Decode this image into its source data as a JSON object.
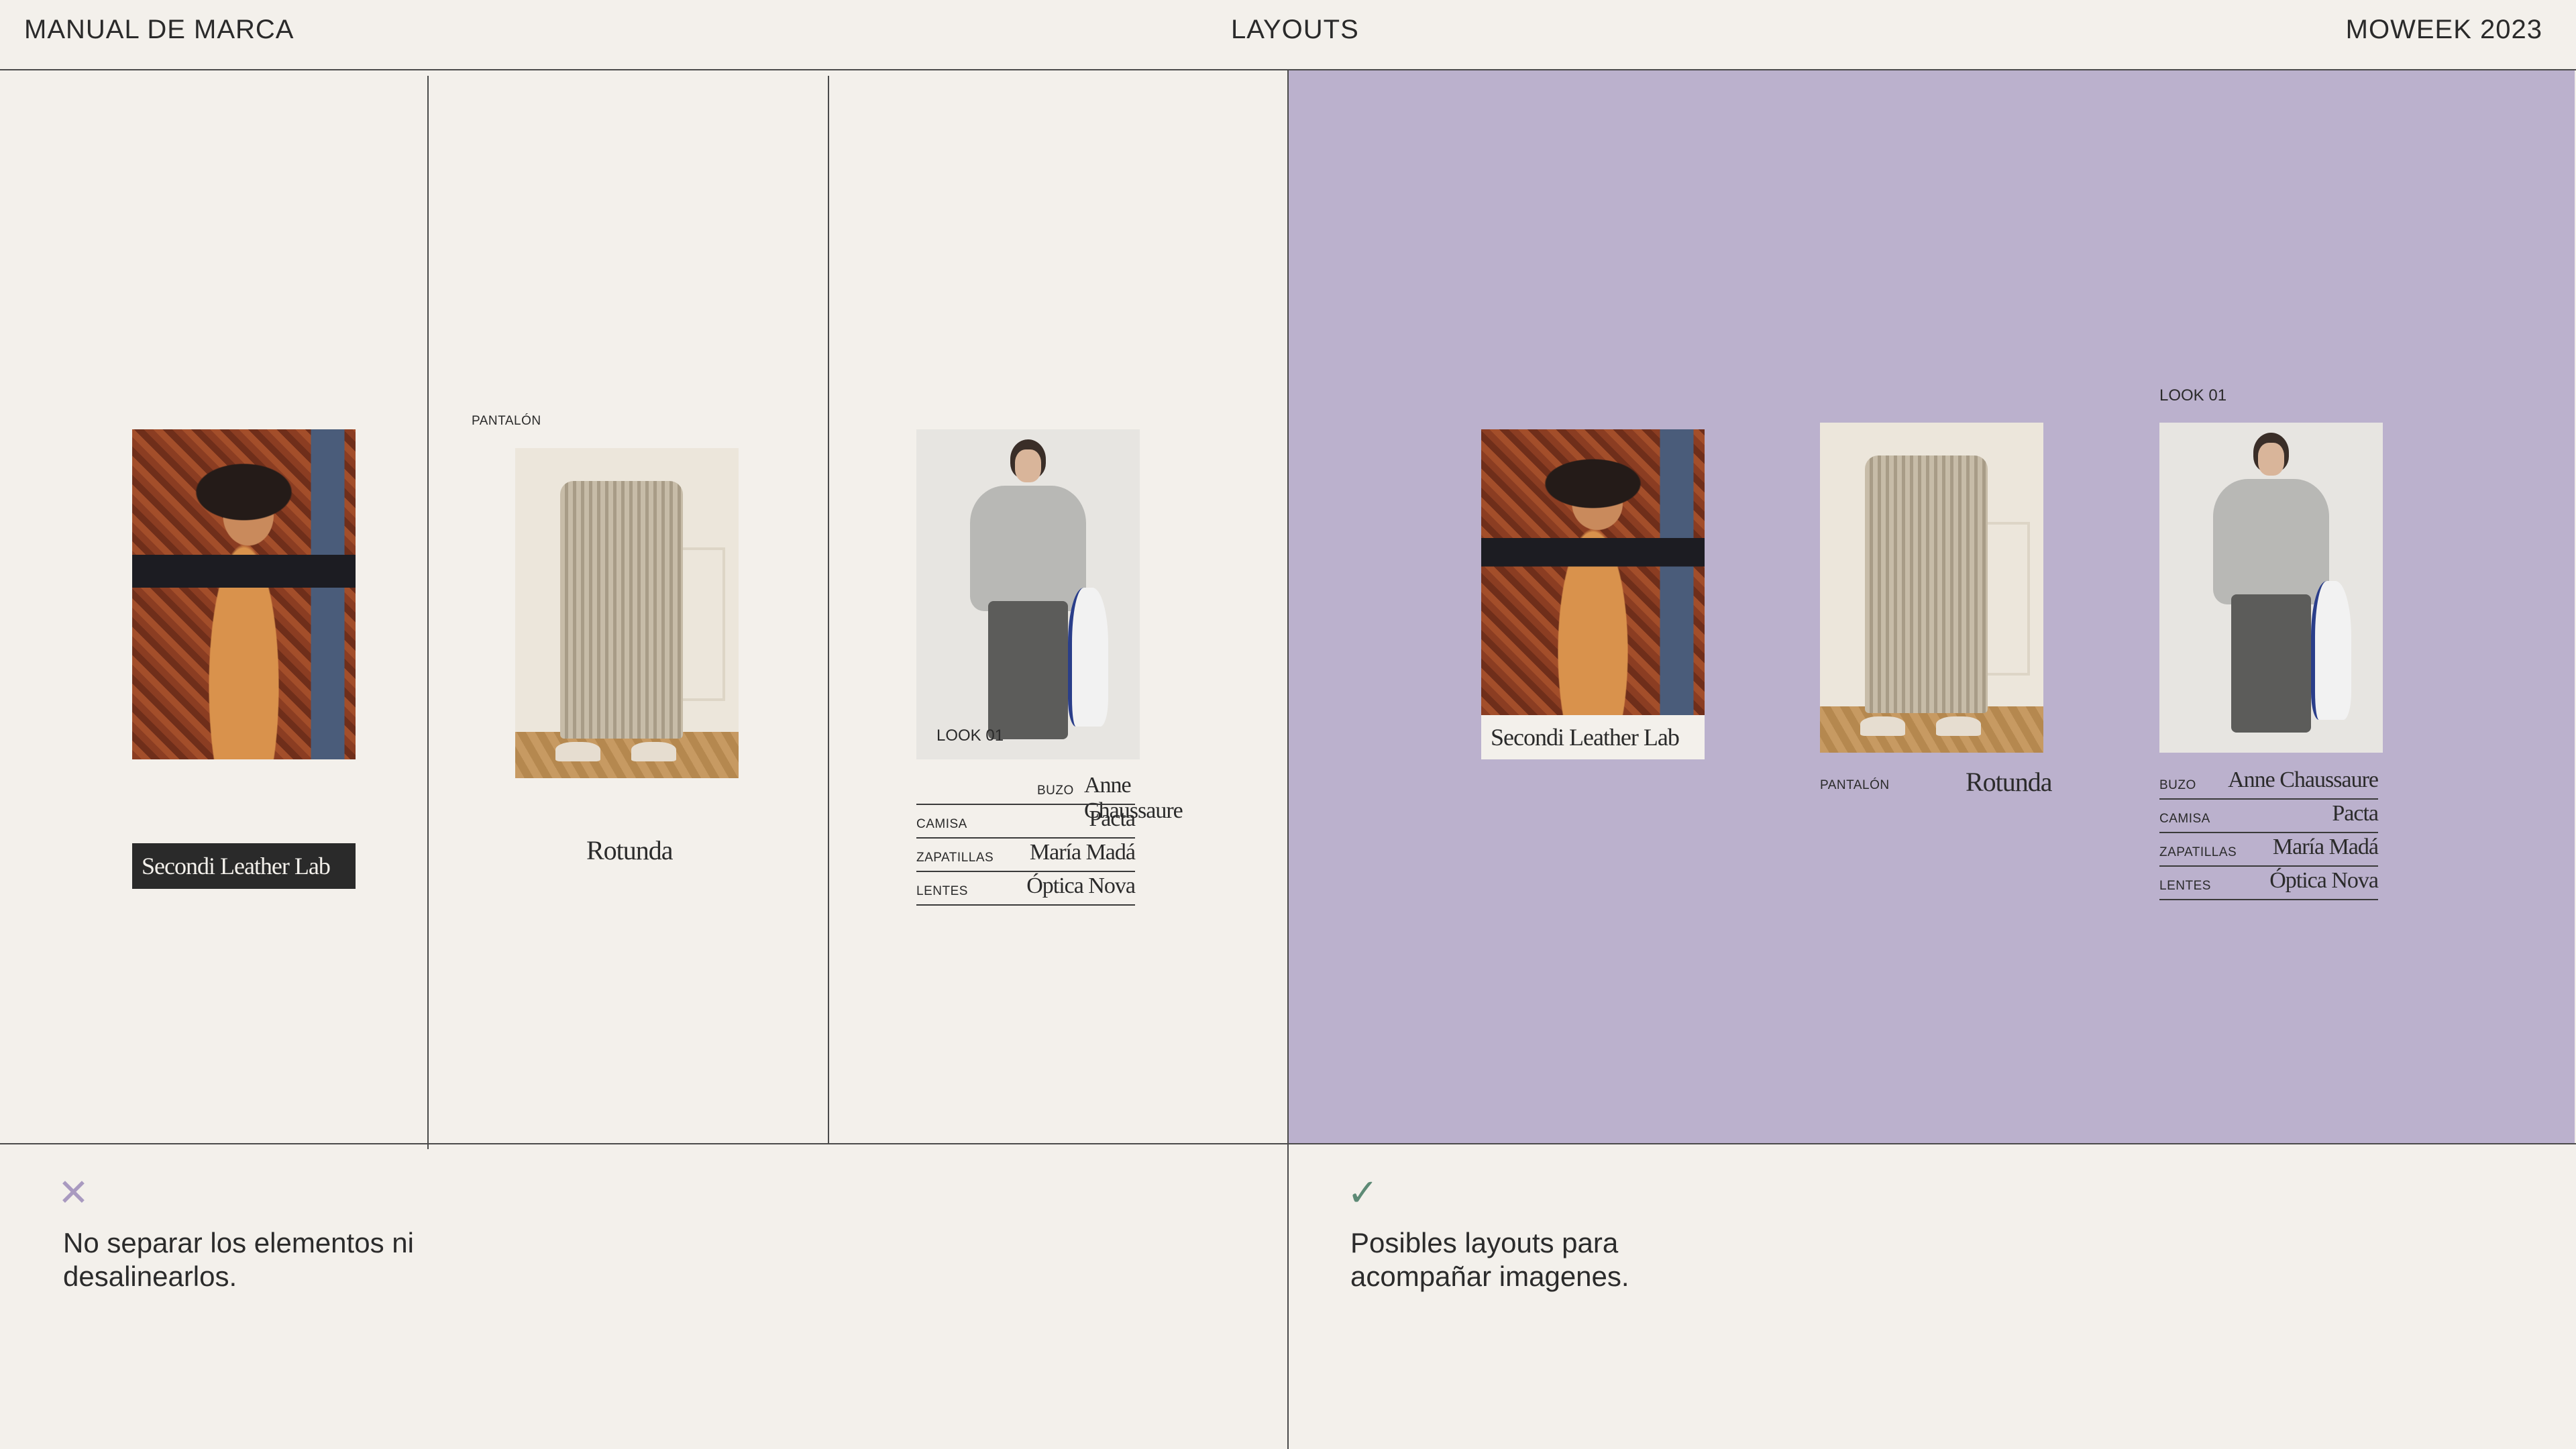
{
  "header": {
    "left": "MANUAL DE MARCA",
    "center": "LAYOUTS",
    "right": "MOWEEK 2023"
  },
  "left_panel": {
    "col1": {
      "brand": "Secondi Leather Lab"
    },
    "col2": {
      "label": "PANTALÓN",
      "brand": "Rotunda"
    },
    "col3": {
      "overlay": "LOOK 01",
      "items": [
        {
          "label": "BUZO",
          "brand": "Anne Chaussaure"
        },
        {
          "label": "CAMISA",
          "brand": "Pacta"
        },
        {
          "label": "ZAPATILLAS",
          "brand": "María Madá"
        },
        {
          "label": "LENTES",
          "brand": "Óptica Nova"
        }
      ]
    }
  },
  "right_panel": {
    "col1": {
      "brand": "Secondi Leather Lab"
    },
    "col2": {
      "label": "PANTALÓN",
      "brand": "Rotunda"
    },
    "col3": {
      "title": "LOOK 01",
      "items": [
        {
          "label": "BUZO",
          "brand": "Anne Chaussaure"
        },
        {
          "label": "CAMISA",
          "brand": "Pacta"
        },
        {
          "label": "ZAPATILLAS",
          "brand": "María Madá"
        },
        {
          "label": "LENTES",
          "brand": "Óptica Nova"
        }
      ]
    }
  },
  "notes": {
    "dont": {
      "icon": "x-icon",
      "text_line1": "No separar los elementos ni",
      "text_line2": "desalinearlos."
    },
    "do": {
      "icon": "check-icon",
      "text_line1": "Posibles layouts para",
      "text_line2": "acompañar imagenes."
    }
  },
  "colors": {
    "background": "#f3f0eb",
    "accent_purple": "#bbb1cd",
    "x_icon": "#a99ac0",
    "check_icon": "#5d8a75"
  }
}
